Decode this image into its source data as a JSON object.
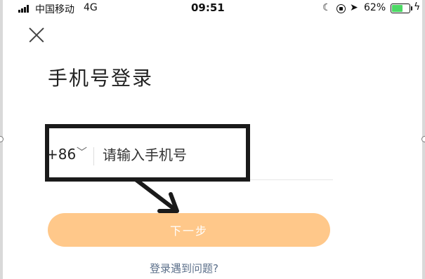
{
  "status_bar": {
    "carrier": "中国移动",
    "network": "4G",
    "time": "09:51",
    "battery_percent": "62%",
    "battery_level": 0.62,
    "battery_color": "#4cd964",
    "icons": [
      "signal-icon",
      "moon-icon",
      "rotation-lock-icon",
      "location-icon",
      "battery-icon",
      "charging-bolt-icon"
    ]
  },
  "header": {
    "close_icon": "close-icon",
    "title": "手机号登录"
  },
  "form": {
    "country_code": "+86",
    "country_chevron": "chevron-down-icon",
    "phone_placeholder": "请输入手机号",
    "phone_value": ""
  },
  "actions": {
    "next_label": "下一步",
    "next_color": "#ffc88a",
    "help_label": "登录遇到问题?",
    "help_color": "#5b6f8a"
  },
  "annotation": {
    "box_color": "#1a1a1a",
    "arrow_icon": "pointer-arrow-icon"
  }
}
